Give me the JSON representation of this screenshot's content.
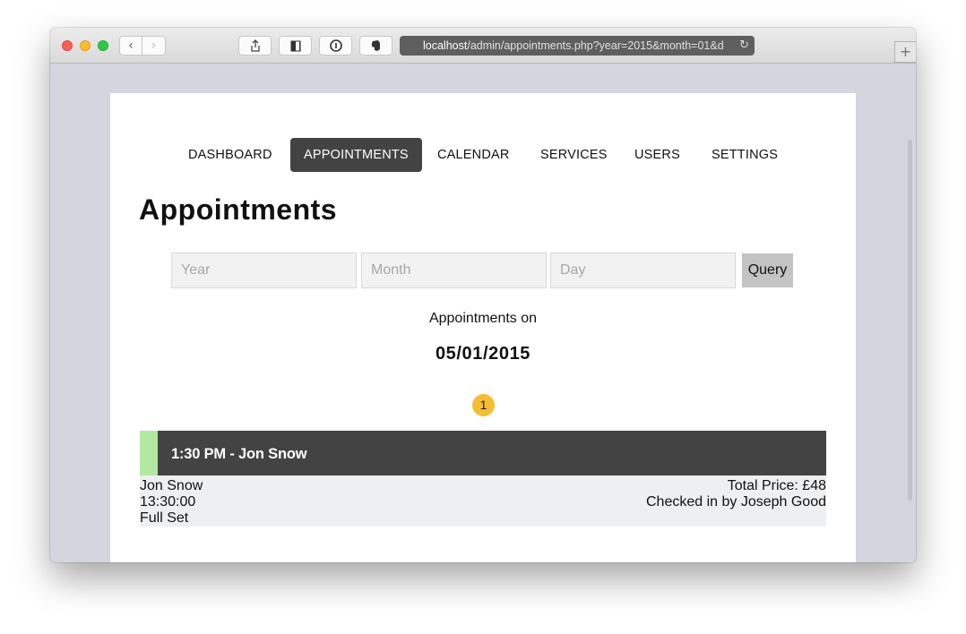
{
  "browser": {
    "url_host": "localhost",
    "url_path": "/admin/appointments.php?year=2015&month=01&d"
  },
  "nav": {
    "items": [
      {
        "label": "DASHBOARD"
      },
      {
        "label": "APPOINTMENTS"
      },
      {
        "label": "CALENDAR"
      },
      {
        "label": "SERVICES"
      },
      {
        "label": "USERS"
      },
      {
        "label": "SETTINGS"
      }
    ],
    "active": "APPOINTMENTS"
  },
  "page": {
    "title": "Appointments"
  },
  "query": {
    "year_placeholder": "Year",
    "month_placeholder": "Month",
    "day_placeholder": "Day",
    "button_label": "Query"
  },
  "results": {
    "heading": "Appointments on",
    "date": "05/01/2015",
    "count": "1"
  },
  "appointments": [
    {
      "title": "1:30 PM - Jon Snow",
      "name": "Jon Snow",
      "time": "13:30:00",
      "service": "Full Set",
      "total_price": "Total Price: £48",
      "checked_in": "Checked in by Joseph Good",
      "status_color": "#b2e8a0"
    }
  ],
  "colors": {
    "nav_active_bg": "#434343",
    "appointment_header_bg": "#434343",
    "badge": "#f5bc36"
  }
}
